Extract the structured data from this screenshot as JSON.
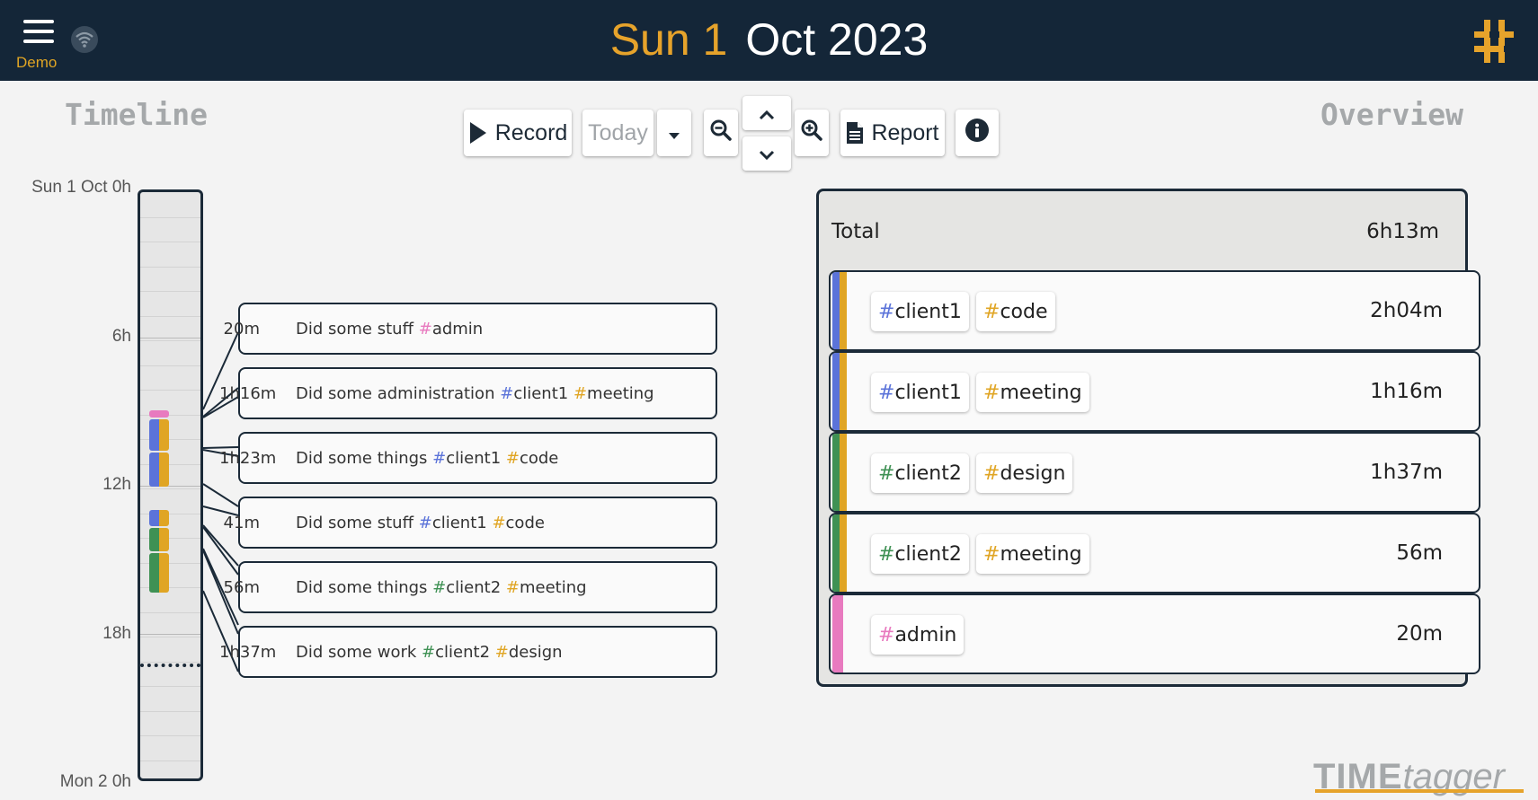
{
  "header": {
    "menu_label": "Demo",
    "date_day": "Sun 1",
    "date_rest": "Oct 2023",
    "wifi_icon": "wifi-icon",
    "logo_icon": "timetagger-logo-icon"
  },
  "timeline": {
    "title": "Timeline",
    "ticks": [
      "Sun 1 Oct  0h",
      "6h",
      "12h",
      "18h",
      "Mon 2  0h"
    ]
  },
  "overview": {
    "title": "Overview",
    "total_label": "Total",
    "total_value": "6h13m",
    "rows": [
      {
        "tags": [
          "client1",
          "code"
        ],
        "tag_colors": [
          "#5b73d9",
          "#e0a524"
        ],
        "duration": "2h04m"
      },
      {
        "tags": [
          "client1",
          "meeting"
        ],
        "tag_colors": [
          "#5b73d9",
          "#e0a524"
        ],
        "duration": "1h16m"
      },
      {
        "tags": [
          "client2",
          "design"
        ],
        "tag_colors": [
          "#3f9154",
          "#e0a524"
        ],
        "duration": "1h37m"
      },
      {
        "tags": [
          "client2",
          "meeting"
        ],
        "tag_colors": [
          "#3f9154",
          "#e0a524"
        ],
        "duration": "56m"
      },
      {
        "tags": [
          "admin"
        ],
        "tag_colors": [
          "#e87abf"
        ],
        "duration": "20m"
      }
    ]
  },
  "toolbar": {
    "record_label": "Record",
    "today_label": "Today",
    "report_label": "Report",
    "icons": [
      "play-icon",
      "caret-down-icon",
      "zoom-out-icon",
      "chevron-up-icon",
      "chevron-down-icon",
      "zoom-in-icon",
      "document-icon",
      "info-icon"
    ]
  },
  "records": [
    {
      "duration": "20m",
      "text": "Did some stuff",
      "tags": [
        {
          "name": "admin",
          "color": "#e87abf"
        }
      ]
    },
    {
      "duration": "1h16m",
      "text": "Did some administration",
      "tags": [
        {
          "name": "client1",
          "color": "#5b73d9"
        },
        {
          "name": "meeting",
          "color": "#e0a524"
        }
      ]
    },
    {
      "duration": "1h23m",
      "text": "Did some things",
      "tags": [
        {
          "name": "client1",
          "color": "#5b73d9"
        },
        {
          "name": "code",
          "color": "#e0a524"
        }
      ]
    },
    {
      "duration": "41m",
      "text": "Did some stuff",
      "tags": [
        {
          "name": "client1",
          "color": "#5b73d9"
        },
        {
          "name": "code",
          "color": "#e0a524"
        }
      ]
    },
    {
      "duration": "56m",
      "text": "Did some things",
      "tags": [
        {
          "name": "client2",
          "color": "#3f9154"
        },
        {
          "name": "meeting",
          "color": "#e0a524"
        }
      ]
    },
    {
      "duration": "1h37m",
      "text": "Did some work",
      "tags": [
        {
          "name": "client2",
          "color": "#3f9154"
        },
        {
          "name": "design",
          "color": "#e0a524"
        }
      ]
    }
  ],
  "brand": {
    "part1": "TIME",
    "part2": "tagger"
  },
  "colors": {
    "header_bg": "#142638",
    "accent": "#e6a32b",
    "client1": "#5b73d9",
    "client2": "#3f9154",
    "admin": "#e87abf"
  }
}
